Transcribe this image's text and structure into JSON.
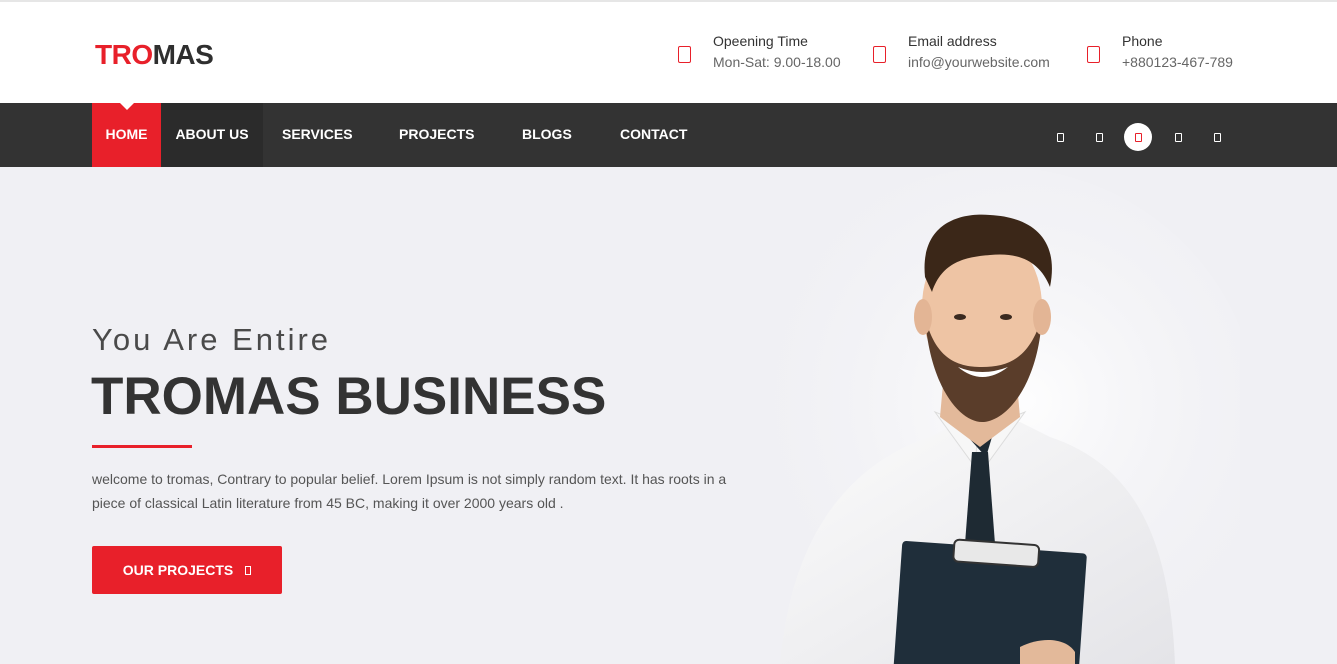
{
  "brand": {
    "logo_part1": "TRO",
    "logo_part2": "MAS"
  },
  "header_info": [
    {
      "icon": "clock-icon",
      "title": "Opeening Time",
      "value": "Mon-Sat: 9.00-18.00"
    },
    {
      "icon": "envelope-icon",
      "title": "Email address",
      "value": "info@yourwebsite.com"
    },
    {
      "icon": "phone-icon",
      "title": "Phone",
      "value": "+880123-467-789"
    }
  ],
  "nav": {
    "items": [
      "HOME",
      "ABOUT US",
      "SERVICES",
      "PROJECTS",
      "BLOGS",
      "CONTACT"
    ],
    "active": "HOME"
  },
  "social": [
    {
      "icon": "facebook-icon"
    },
    {
      "icon": "twitter-icon"
    },
    {
      "icon": "instagram-icon",
      "active": true
    },
    {
      "icon": "linkedin-icon"
    },
    {
      "icon": "pinterest-icon"
    }
  ],
  "hero": {
    "subtitle": "You Are Entire",
    "headline": "TROMAS BUSINESS",
    "paragraph": "welcome to tromas, Contrary to popular belief. Lorem Ipsum is not simply random text. It has roots in a piece of classical Latin literature from 45 BC, making it over 2000 years old .",
    "button_label": "OUR PROJECTS",
    "button_icon": "arrow-right-icon"
  },
  "colors": {
    "accent": "#e8202a",
    "dark": "#333333",
    "hero_bg": "#f0f0f4"
  }
}
